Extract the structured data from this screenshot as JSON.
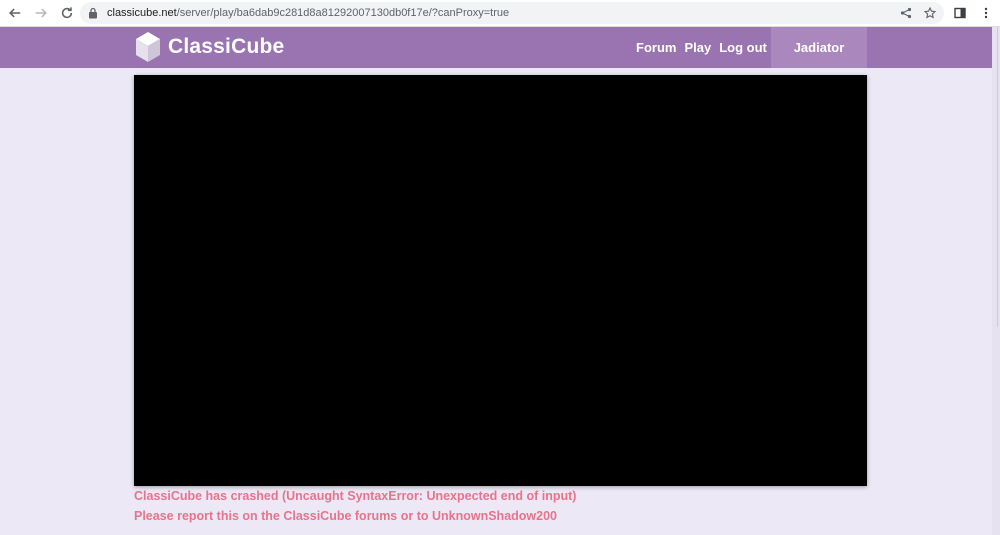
{
  "browser": {
    "url_host": "classicube.net",
    "url_path": "/server/play/ba6dab9c281d8a81292007130db0f17e/?canProxy=true",
    "icons": [
      "back-arrow-icon",
      "forward-arrow-icon",
      "reload-icon",
      "lock-icon",
      "share-icon",
      "star-icon",
      "side-panel-icon",
      "kebab-menu-icon"
    ]
  },
  "header": {
    "logo_text": "ClassiCube",
    "nav": {
      "forum": "Forum",
      "play": "Play",
      "logout": "Log out"
    },
    "username": "Jadiator"
  },
  "game": {
    "crash_line_1": "ClassiCube has crashed (Uncaught SyntaxError: Unexpected end of input)",
    "crash_line_2": "Please report this on the ClassiCube forums or to UnknownShadow200"
  },
  "colors": {
    "header_bg": "#9a74b0",
    "user_tab_bg": "#aa88be",
    "page_bg": "#ece8f6",
    "crash_text": "#e8738c",
    "canvas_bg": "#000000"
  }
}
